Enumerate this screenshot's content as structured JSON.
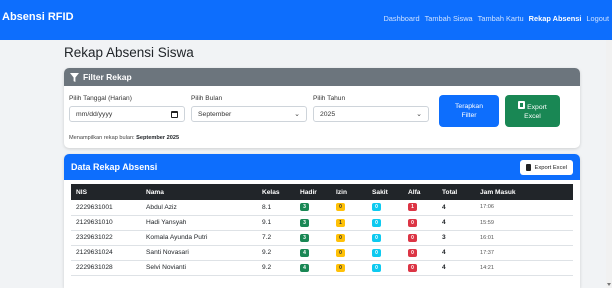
{
  "nav": {
    "brand": "Absensi RFID",
    "links": [
      {
        "label": "Dashboard"
      },
      {
        "label": "Tambah Siswa"
      },
      {
        "label": "Tambah Kartu"
      },
      {
        "label": "Rekap Absensi"
      },
      {
        "label": "Logout"
      }
    ],
    "active": "Rekap Absensi"
  },
  "page": {
    "title": "Rekap Absensi Siswa"
  },
  "filter": {
    "header": "Filter Rekap",
    "date_label": "Pilih Tanggal (Harian)",
    "date_placeholder": "mm/dd/yyyy",
    "month_label": "Pilih Bulan",
    "month_value": "September",
    "year_label": "Pilih Tahun",
    "year_value": "2025",
    "apply_label_line1": "Terapkan",
    "apply_label_line2": "Filter",
    "export_label_line1": "Export",
    "export_label_line2": "Excel",
    "note_prefix": "Menampilkan rekap bulan:",
    "note_value": "September 2025"
  },
  "data": {
    "header": "Data Rekap Absensi",
    "export_label": "Export Excel",
    "columns": [
      "NIS",
      "Nama",
      "Kelas",
      "Hadir",
      "Izin",
      "Sakit",
      "Alfa",
      "Total",
      "Jam Masuk"
    ],
    "rows": [
      {
        "nis": "2229631001",
        "nama": "Abdul Aziz",
        "kelas": "8.1",
        "hadir": "3",
        "izin": "0",
        "sakit": "0",
        "alfa": "1",
        "total": "4",
        "jam": "17:06"
      },
      {
        "nis": "2129631010",
        "nama": "Hadi Yansyah",
        "kelas": "9.1",
        "hadir": "3",
        "izin": "1",
        "sakit": "0",
        "alfa": "0",
        "total": "4",
        "jam": "15:59"
      },
      {
        "nis": "2329631022",
        "nama": "Komala Ayunda Putri",
        "kelas": "7.2",
        "hadir": "3",
        "izin": "0",
        "sakit": "0",
        "alfa": "0",
        "total": "3",
        "jam": "16:01"
      },
      {
        "nis": "2129631024",
        "nama": "Santi Novasari",
        "kelas": "9.2",
        "hadir": "4",
        "izin": "0",
        "sakit": "0",
        "alfa": "0",
        "total": "4",
        "jam": "17:37"
      },
      {
        "nis": "2229631028",
        "nama": "Selvi Novianti",
        "kelas": "9.2",
        "hadir": "4",
        "izin": "0",
        "sakit": "0",
        "alfa": "0",
        "total": "4",
        "jam": "14:21"
      }
    ]
  },
  "colors": {
    "primary": "#0d6efd",
    "secondary": "#6c757d",
    "success": "#198754",
    "warning": "#ffc107",
    "info": "#0dcaf0",
    "danger": "#dc3545",
    "dark": "#212529"
  },
  "icons": {
    "filter": "funnel-icon",
    "export": "file-excel-icon",
    "date": "calendar-icon",
    "select": "chevron-down-icon"
  }
}
